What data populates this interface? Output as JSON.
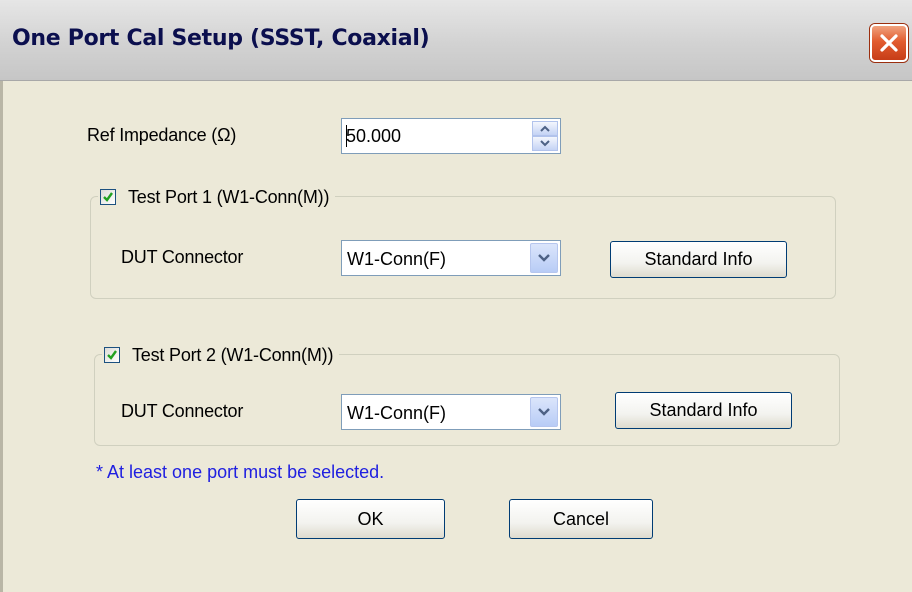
{
  "window": {
    "title": "One Port Cal Setup (SSST, Coaxial)",
    "close_icon": "close-icon"
  },
  "ref_impedance": {
    "label": "Ref Impedance (Ω)",
    "value": "50.000"
  },
  "port1": {
    "checked": true,
    "label": "Test Port 1 (W1-Conn(M))",
    "dut_label": "DUT Connector",
    "dut_value": "W1-Conn(F)",
    "standard_info_label": "Standard Info"
  },
  "port2": {
    "checked": true,
    "label": "Test Port 2 (W1-Conn(M))",
    "dut_label": "DUT Connector",
    "dut_value": "W1-Conn(F)",
    "standard_info_label": "Standard Info"
  },
  "note": "* At least one port must be selected.",
  "buttons": {
    "ok": "OK",
    "cancel": "Cancel"
  },
  "colors": {
    "title_text": "#0b0f4e",
    "note_text": "#2020e0",
    "close_button": "#e25c2f",
    "checkmark": "#21a121",
    "dialog_bg": "#ece9d8"
  }
}
